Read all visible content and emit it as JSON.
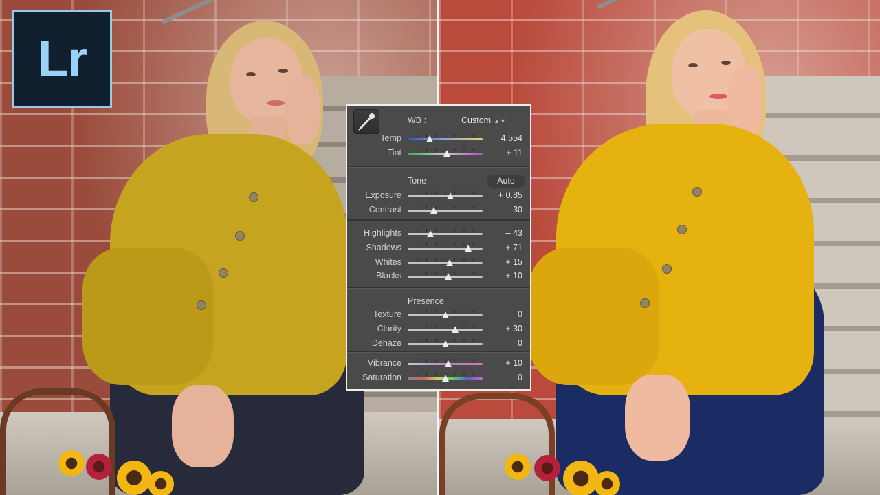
{
  "logo": {
    "text": "Lr"
  },
  "panel": {
    "wb": {
      "label": "WB :",
      "value": "Custom"
    },
    "white_balance": [
      {
        "id": "temp",
        "label": "Temp",
        "value": "4,554",
        "position": 0.29
      },
      {
        "id": "tint",
        "label": "Tint",
        "value": "+ 11",
        "position": 0.52
      }
    ],
    "tone_title": "Tone",
    "auto_label": "Auto",
    "tone": [
      {
        "id": "exposure",
        "label": "Exposure",
        "value": "+ 0.85",
        "position": 0.57
      },
      {
        "id": "contrast",
        "label": "Contrast",
        "value": "– 30",
        "position": 0.35
      }
    ],
    "tone2": [
      {
        "id": "highlights",
        "label": "Highlights",
        "value": "– 43",
        "position": 0.3
      },
      {
        "id": "shadows",
        "label": "Shadows",
        "value": "+ 71",
        "position": 0.81
      },
      {
        "id": "whites",
        "label": "Whites",
        "value": "+ 15",
        "position": 0.56
      },
      {
        "id": "blacks",
        "label": "Blacks",
        "value": "+ 10",
        "position": 0.54
      }
    ],
    "presence_title": "Presence",
    "presence": [
      {
        "id": "texture",
        "label": "Texture",
        "value": "0",
        "position": 0.5
      },
      {
        "id": "clarity",
        "label": "Clarity",
        "value": "+ 30",
        "position": 0.63
      },
      {
        "id": "dehaze",
        "label": "Dehaze",
        "value": "0",
        "position": 0.5
      }
    ],
    "color": [
      {
        "id": "vibrance",
        "label": "Vibrance",
        "value": "+ 10",
        "position": 0.54
      },
      {
        "id": "saturation",
        "label": "Saturation",
        "value": "0",
        "position": 0.5
      }
    ]
  },
  "colors": {
    "panel_bg": "#4a4a4a",
    "logo_bg": "#11202e",
    "logo_accent": "#9ad2f6"
  }
}
